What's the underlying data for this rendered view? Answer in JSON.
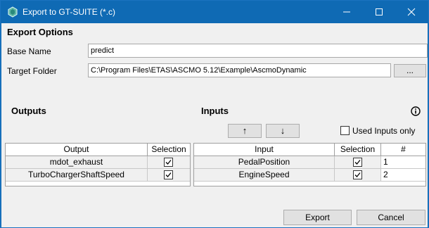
{
  "window": {
    "title": "Export to GT-SUITE (*.c)"
  },
  "form": {
    "section_title": "Export Options",
    "base_name_label": "Base Name",
    "base_name_value": "predict",
    "target_folder_label": "Target Folder",
    "target_folder_value": "C:\\Program Files\\ETAS\\ASCMO 5.12\\Example\\AscmoDynamic",
    "browse_label": "..."
  },
  "outputs": {
    "title": "Outputs",
    "columns": [
      "Output",
      "Selection"
    ],
    "rows": [
      {
        "name": "mdot_exhaust",
        "selected": true
      },
      {
        "name": "TurboChargerShaftSpeed",
        "selected": true
      }
    ]
  },
  "inputs": {
    "title": "Inputs",
    "up_label": "↑",
    "down_label": "↓",
    "used_inputs_label": "Used Inputs only",
    "used_inputs_checked": false,
    "columns": [
      "Input",
      "Selection",
      "#"
    ],
    "rows": [
      {
        "name": "PedalPosition",
        "selected": true,
        "index": "1"
      },
      {
        "name": "EngineSpeed",
        "selected": true,
        "index": "2"
      }
    ]
  },
  "footer": {
    "export_label": "Export",
    "cancel_label": "Cancel"
  },
  "icons": [
    "app-icon",
    "minimize-icon",
    "maximize-icon",
    "close-icon",
    "info-icon",
    "checkmark-icon"
  ],
  "colors": {
    "titlebar": "#0f6ab4",
    "client_bg": "#f0f0f0"
  }
}
